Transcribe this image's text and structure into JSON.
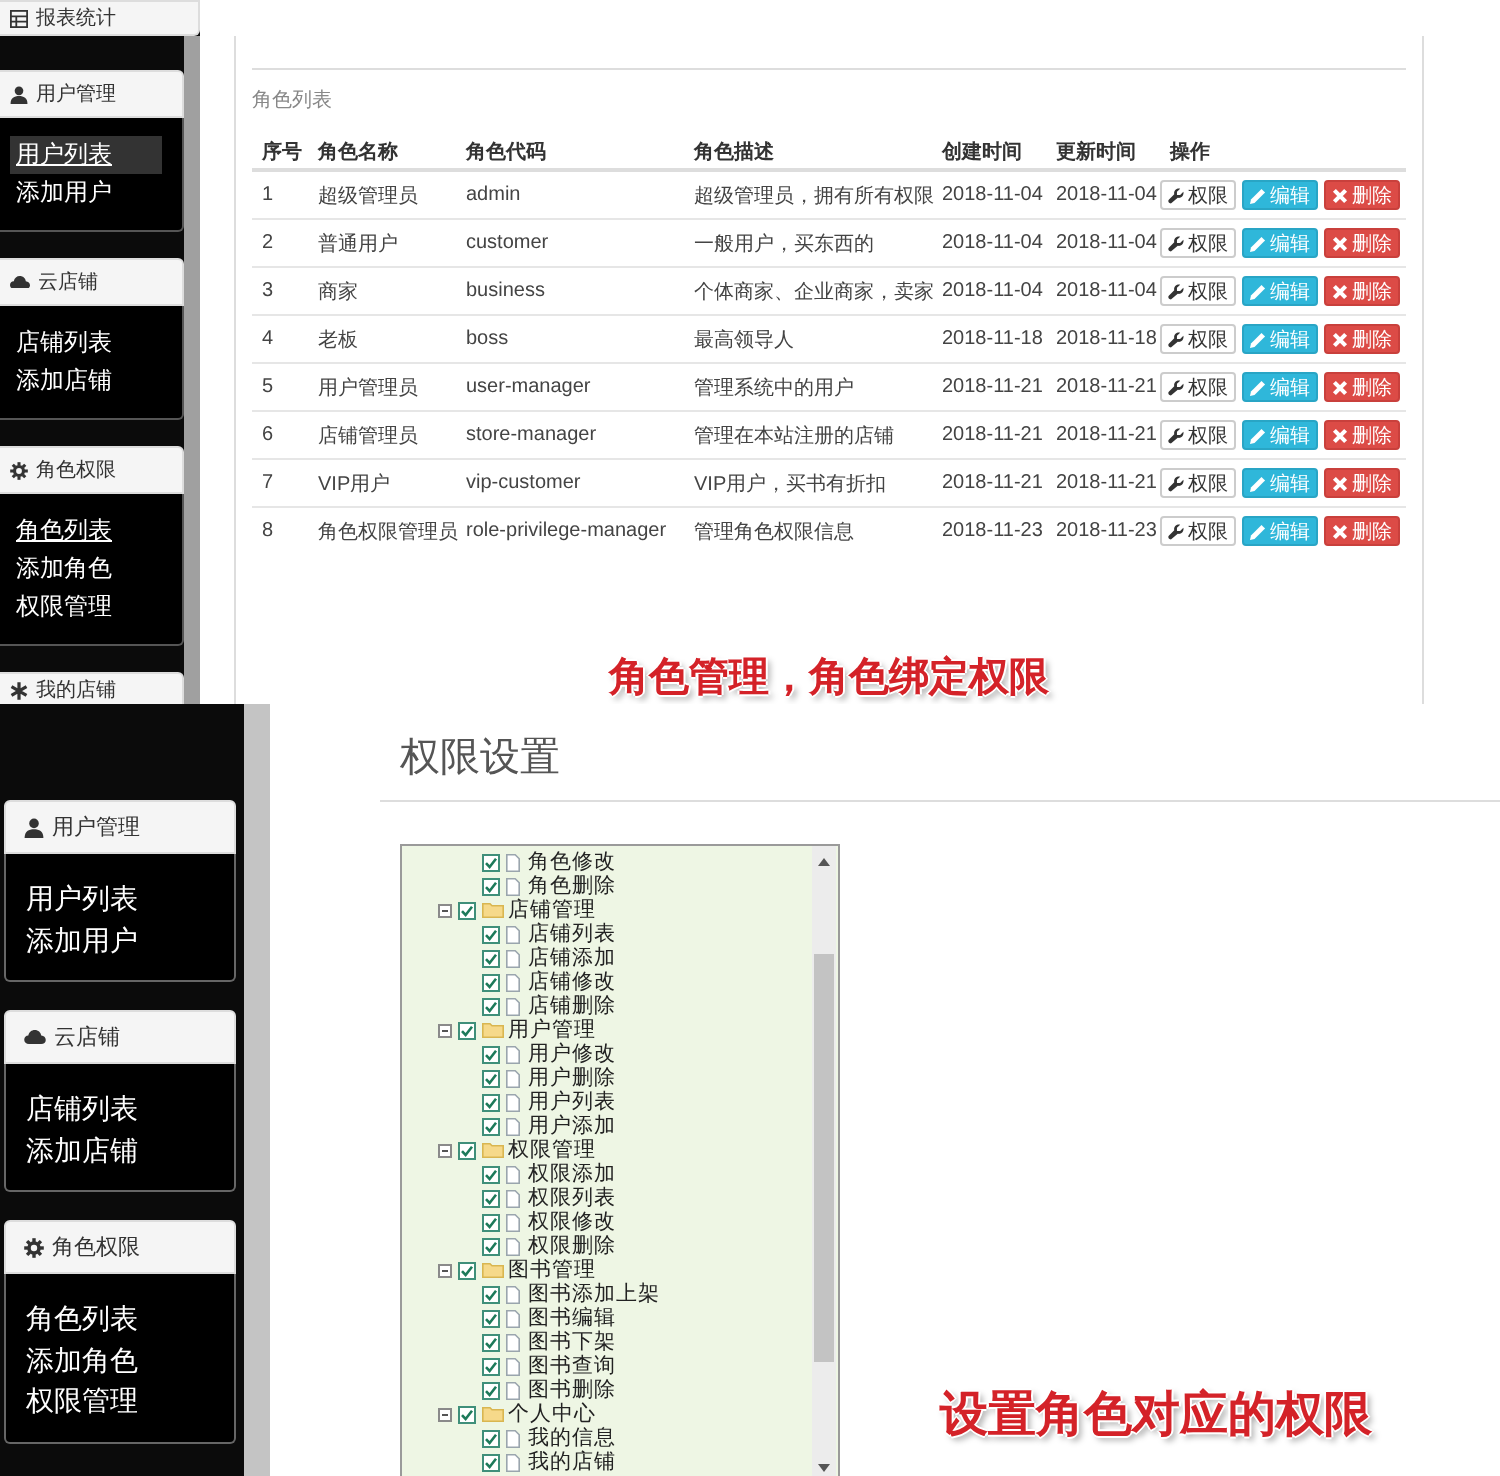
{
  "role_page": {
    "sidebar": {
      "panels": [
        {
          "title": "报表统计"
        },
        {
          "title": "用户管理",
          "items": [
            {
              "label": "用户列表",
              "selected": true,
              "underlined": true
            },
            {
              "label": "添加用户",
              "selected": false,
              "underlined": false
            }
          ]
        },
        {
          "title": "云店铺",
          "items": [
            {
              "label": "店铺列表",
              "selected": false,
              "underlined": false
            },
            {
              "label": "添加店铺",
              "selected": false,
              "underlined": false
            }
          ]
        },
        {
          "title": "角色权限",
          "items": [
            {
              "label": "角色列表",
              "selected": false,
              "underlined": true
            },
            {
              "label": "添加角色",
              "selected": false,
              "underlined": false
            },
            {
              "label": "权限管理",
              "selected": false,
              "underlined": false
            }
          ]
        },
        {
          "title": "我的店铺"
        }
      ]
    },
    "panel_title": "角色列表",
    "table": {
      "columns": [
        "序号",
        "角色名称",
        "角色代码",
        "角色描述",
        "创建时间",
        "更新时间",
        "操作"
      ],
      "rows": [
        {
          "cells": [
            "1",
            "超级管理员",
            "admin",
            "超级管理员，拥有所有权限",
            "2018-11-04",
            "2018-11-04"
          ],
          "actions": [
            {
              "kind": "privilege",
              "label": "权限"
            },
            {
              "kind": "edit",
              "label": "编辑"
            },
            {
              "kind": "delete",
              "label": "删除"
            }
          ]
        },
        {
          "cells": [
            "2",
            "普通用户",
            "customer",
            "一般用户，买东西的",
            "2018-11-04",
            "2018-11-04"
          ],
          "actions": [
            {
              "kind": "privilege",
              "label": "权限"
            },
            {
              "kind": "edit",
              "label": "编辑"
            },
            {
              "kind": "delete",
              "label": "删除"
            }
          ]
        },
        {
          "cells": [
            "3",
            "商家",
            "business",
            "个体商家、企业商家，卖家",
            "2018-11-04",
            "2018-11-04"
          ],
          "actions": [
            {
              "kind": "privilege",
              "label": "权限"
            },
            {
              "kind": "edit",
              "label": "编辑"
            },
            {
              "kind": "delete",
              "label": "删除"
            }
          ]
        },
        {
          "cells": [
            "4",
            "老板",
            "boss",
            "最高领导人",
            "2018-11-18",
            "2018-11-18"
          ],
          "actions": [
            {
              "kind": "privilege",
              "label": "权限"
            },
            {
              "kind": "edit",
              "label": "编辑"
            },
            {
              "kind": "delete",
              "label": "删除"
            }
          ]
        },
        {
          "cells": [
            "5",
            "用户管理员",
            "user-manager",
            "管理系统中的用户",
            "2018-11-21",
            "2018-11-21"
          ],
          "actions": [
            {
              "kind": "privilege",
              "label": "权限"
            },
            {
              "kind": "edit",
              "label": "编辑"
            },
            {
              "kind": "delete",
              "label": "删除"
            }
          ]
        },
        {
          "cells": [
            "6",
            "店铺管理员",
            "store-manager",
            "管理在本站注册的店铺",
            "2018-11-21",
            "2018-11-21"
          ],
          "actions": [
            {
              "kind": "privilege",
              "label": "权限"
            },
            {
              "kind": "edit",
              "label": "编辑"
            },
            {
              "kind": "delete",
              "label": "删除"
            }
          ]
        },
        {
          "cells": [
            "7",
            "VIP用户",
            "vip-customer",
            "VIP用户，买书有折扣",
            "2018-11-21",
            "2018-11-21"
          ],
          "actions": [
            {
              "kind": "privilege",
              "label": "权限"
            },
            {
              "kind": "edit",
              "label": "编辑"
            },
            {
              "kind": "delete",
              "label": "删除"
            }
          ]
        },
        {
          "cells": [
            "8",
            "角色权限管理员",
            "role-privilege-manager",
            "管理角色权限信息",
            "2018-11-23",
            "2018-11-23"
          ],
          "actions": [
            {
              "kind": "privilege",
              "label": "权限"
            },
            {
              "kind": "edit",
              "label": "编辑"
            },
            {
              "kind": "delete",
              "label": "删除"
            }
          ]
        }
      ]
    },
    "caption": "角色管理，角色绑定权限"
  },
  "privilege_page": {
    "sidebar": {
      "panels": [
        {
          "title": "用户管理",
          "items": [
            {
              "label": "用户列表",
              "selected": false
            },
            {
              "label": "添加用户",
              "selected": false
            }
          ]
        },
        {
          "title": "云店铺",
          "items": [
            {
              "label": "店铺列表",
              "selected": false
            },
            {
              "label": "添加店铺",
              "selected": false
            }
          ]
        },
        {
          "title": "角色权限",
          "items": [
            {
              "label": "角色列表",
              "selected": false
            },
            {
              "label": "添加角色",
              "selected": false
            },
            {
              "label": "权限管理",
              "selected": false
            }
          ]
        }
      ]
    },
    "heading": "权限设置",
    "tree": {
      "nodes": [
        {
          "children": [
            {
              "label": "角色修改",
              "checked": true
            },
            {
              "label": "角色删除",
              "checked": true
            }
          ]
        },
        {
          "label": "店铺管理",
          "checked": true,
          "expanded": true,
          "children": [
            {
              "label": "店铺列表",
              "checked": true
            },
            {
              "label": "店铺添加",
              "checked": true
            },
            {
              "label": "店铺修改",
              "checked": true
            },
            {
              "label": "店铺删除",
              "checked": true
            }
          ]
        },
        {
          "label": "用户管理",
          "checked": true,
          "expanded": true,
          "children": [
            {
              "label": "用户修改",
              "checked": true
            },
            {
              "label": "用户删除",
              "checked": true
            },
            {
              "label": "用户列表",
              "checked": true
            },
            {
              "label": "用户添加",
              "checked": true
            }
          ]
        },
        {
          "label": "权限管理",
          "checked": true,
          "expanded": true,
          "children": [
            {
              "label": "权限添加",
              "checked": true
            },
            {
              "label": "权限列表",
              "checked": true
            },
            {
              "label": "权限修改",
              "checked": true
            },
            {
              "label": "权限删除",
              "checked": true
            }
          ]
        },
        {
          "label": "图书管理",
          "checked": true,
          "expanded": true,
          "children": [
            {
              "label": "图书添加上架",
              "checked": true
            },
            {
              "label": "图书编辑",
              "checked": true
            },
            {
              "label": "图书下架",
              "checked": true
            },
            {
              "label": "图书查询",
              "checked": true
            },
            {
              "label": "图书删除",
              "checked": true
            }
          ]
        },
        {
          "label": "个人中心",
          "checked": true,
          "expanded": true,
          "children": [
            {
              "label": "我的信息",
              "checked": true
            },
            {
              "label": "我的店铺",
              "checked": true
            }
          ]
        }
      ]
    },
    "caption": "设置角色对应的权限"
  }
}
